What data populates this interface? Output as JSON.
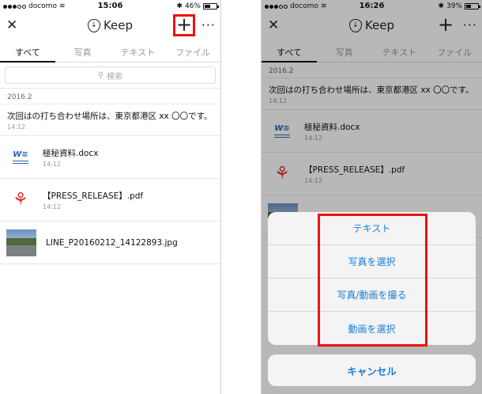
{
  "left": {
    "status": {
      "carrier": "docomo",
      "time": "15:06",
      "battery_pct": "46%",
      "battery_level": 0.46
    },
    "nav": {
      "title": "Keep",
      "plus": "+",
      "more": "···",
      "close": "✕"
    },
    "tabs": [
      {
        "label": "すべて"
      },
      {
        "label": "写真"
      },
      {
        "label": "テキスト"
      },
      {
        "label": "ファイル"
      }
    ],
    "search_placeholder": "検索",
    "date_header": "2016.2",
    "note": {
      "text": "次回はの打ち合わせ場所は、東京都港区 xx 〇〇です。",
      "time": "14:12"
    },
    "items": [
      {
        "name": "極秘資料.docx",
        "time": "14:12",
        "icon": "word-file-icon"
      },
      {
        "name": "【PRESS_RELEASE】.pdf",
        "time": "14:12",
        "icon": "pdf-file-icon"
      },
      {
        "name": "LINE_P20160212_14122893.jpg",
        "time": "",
        "icon": "photo-thumbnail"
      }
    ]
  },
  "right": {
    "status": {
      "carrier": "docomo",
      "time": "16:26",
      "battery_pct": "39%",
      "battery_level": 0.39
    },
    "nav": {
      "title": "Keep",
      "plus": "+",
      "more": "···",
      "close": "✕"
    },
    "tabs": [
      {
        "label": "すべて"
      },
      {
        "label": "写真"
      },
      {
        "label": "テキスト"
      },
      {
        "label": "ファイル"
      }
    ],
    "date_header": "2016.2",
    "note": {
      "text": "次回はの打ち合わせ場所は、東京都港区 xx 〇〇です。",
      "time": "14:12"
    },
    "items": [
      {
        "name": "極秘資料.docx",
        "time": "14:12"
      },
      {
        "name": "【PRESS_RELEASE】.pdf",
        "time": "14:12"
      }
    ],
    "sheet": {
      "options": [
        "テキスト",
        "写真を選択",
        "写真/動画を撮る",
        "動画を選択"
      ],
      "cancel": "キャンセル"
    }
  },
  "colors": {
    "accent": "#1a7fd8",
    "highlight": "#e11111"
  }
}
